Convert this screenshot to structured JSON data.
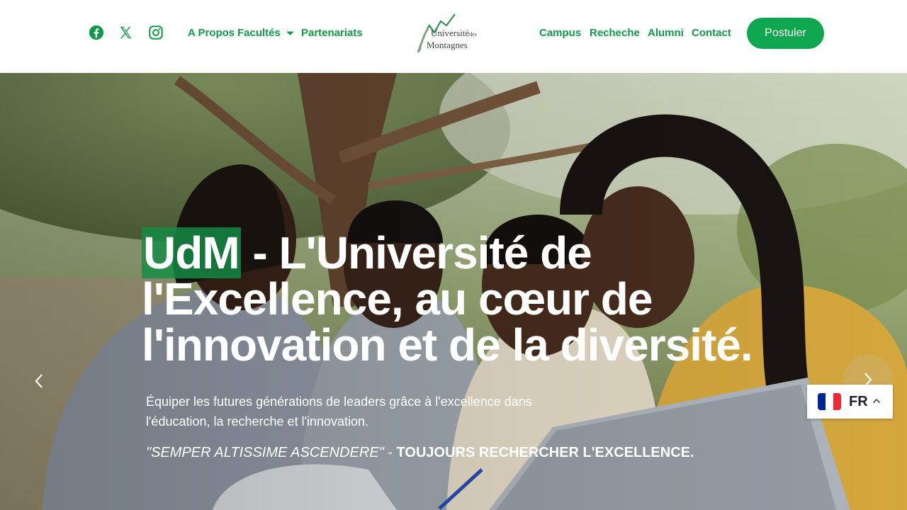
{
  "header": {
    "social": [
      {
        "icon": "facebook-icon",
        "label": "Facebook"
      },
      {
        "icon": "x-twitter-icon",
        "label": "X"
      },
      {
        "icon": "instagram-icon",
        "label": "Instagram"
      }
    ],
    "nav_left": [
      "A Propos",
      "Facultés",
      "Partenariats"
    ],
    "nav_right": [
      "Campus",
      "Recheche",
      "Alumni",
      "Contact"
    ],
    "logo": {
      "line1": "Université",
      "line1_small": "des",
      "line2": "Montagnes"
    },
    "apply_label": "Postuler"
  },
  "hero": {
    "title_highlight": "UdM",
    "title_rest": " - L'Université de l'Excellence, au cœur de l'innovation et de la diversité.",
    "subtitle": "Équiper les futures générations de leaders grâce à l'excellence dans l'éducation, la recherche et l'innovation.",
    "motto_latin": "\"SEMPER ALTISSIME ASCENDERE\"",
    "motto_sep": " - ",
    "motto_fr": "TOUJOURS RECHERCHER L'EXCELLENCE."
  },
  "language": {
    "code": "FR",
    "flag": "france-flag-icon"
  },
  "colors": {
    "brand_green": "#0fa650",
    "nav_green": "#0f9a4a",
    "highlight": "#148c46"
  }
}
